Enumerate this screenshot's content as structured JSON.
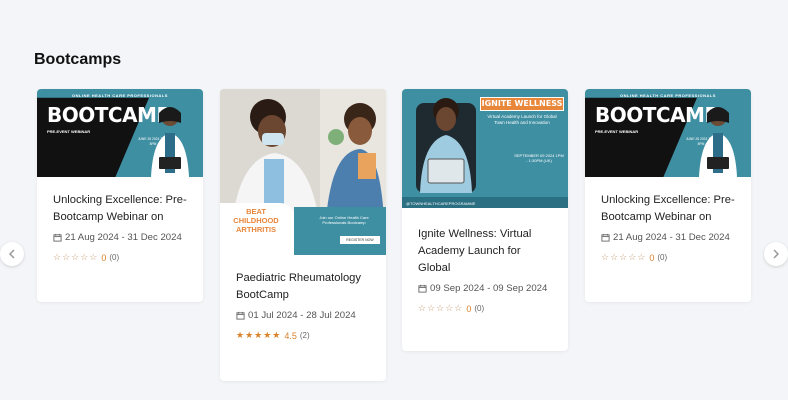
{
  "section": {
    "title": "Bootcamps"
  },
  "colors": {
    "accent": "#3f8fa3",
    "star": "#d9822b",
    "banner_orange": "#e8863a",
    "background": "#f3f5f8"
  },
  "nav": {
    "prev_icon": "chevron-left-icon",
    "next_icon": "chevron-right-icon"
  },
  "cards": [
    {
      "title": "Unlocking Excellence: Pre-Bootcamp Webinar on",
      "date": "21 Aug 2024 - 31 Dec 2024",
      "stars": "☆☆☆☆☆",
      "rating_value": "0",
      "rating_count": "(0)",
      "banner": {
        "top": "ONLINE HEALTH CARE PROFESSIONALS",
        "headline": "BOOTCAMP",
        "sub": "PRE-EVENT WEBINAR",
        "info": "JUNE 28 2024 7PM-8PM"
      }
    },
    {
      "title": "Paediatric Rheumatology BootCamp",
      "date": "01 Jul 2024 - 28 Jul 2024",
      "stars": "★★★★★",
      "rating_value": "4.5",
      "rating_count": "(2)",
      "banner": {
        "headline": "BEAT CHILDHOOD ARTHRITIS",
        "join": "Join our Online Health Care Professionals Bootcamp",
        "cta": "REGISTER NOW"
      }
    },
    {
      "title": "Ignite Wellness: Virtual Academy Launch for Global",
      "date": "09 Sep 2024 - 09 Sep 2024",
      "stars": "☆☆☆☆☆",
      "rating_value": "0",
      "rating_count": "(0)",
      "banner": {
        "headline": "IGNITE WELLNESS",
        "sub": "Virtual Academy Launch for Global Town Health and Innovation",
        "info": "SEPTEMBER 09 2024 1PM - 1:30PM (UK)",
        "handle": "@TOWNHEALTHCAREPROGRAMME"
      }
    },
    {
      "title": "Unlocking Excellence: Pre-Bootcamp Webinar on",
      "date": "21 Aug 2024 - 31 Dec 2024",
      "stars": "☆☆☆☆☆",
      "rating_value": "0",
      "rating_count": "(0)",
      "banner": {
        "top": "ONLINE HEALTH CARE PROFESSIONALS",
        "headline": "BOOTCAMP",
        "sub": "PRE-EVENT WEBINAR",
        "info": "JUNE 28 2024 7PM-8PM"
      }
    }
  ]
}
